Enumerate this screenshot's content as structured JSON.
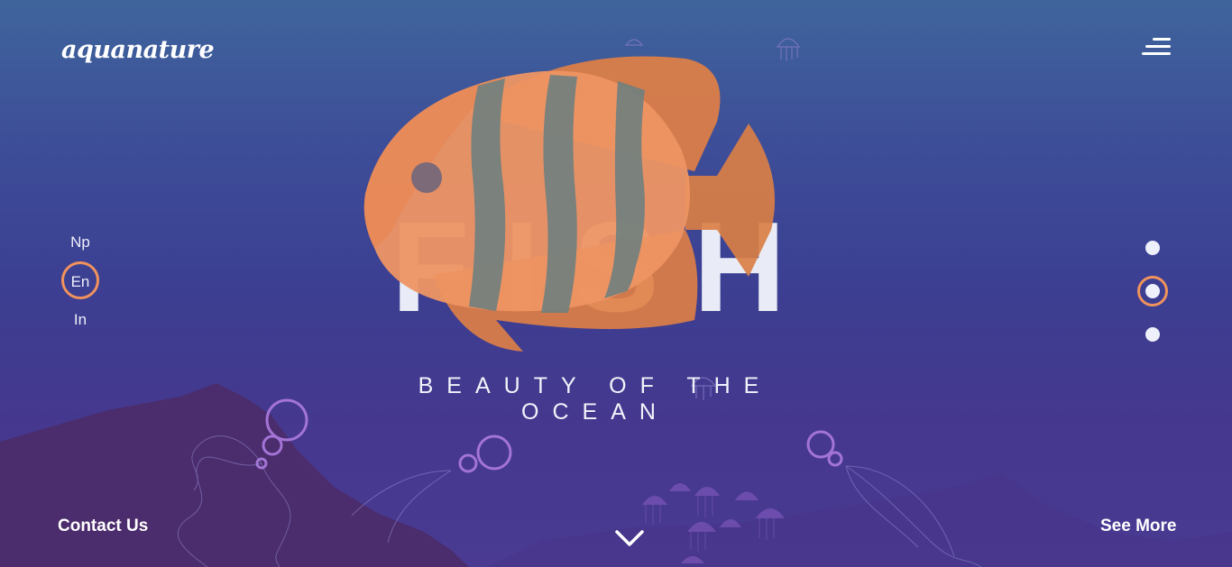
{
  "brand": {
    "logo_text": "aquanature"
  },
  "header": {
    "menu_icon": "hamburger-menu-icon"
  },
  "languages": {
    "items": [
      "Np",
      "En",
      "In"
    ],
    "selected": "En"
  },
  "hero": {
    "title": "FISH",
    "subtitle": "BEAUTY OF THE OCEAN",
    "illustration_icon": "fish-illustration"
  },
  "slider": {
    "total": 3,
    "active": 2
  },
  "footer": {
    "contact_label": "Contact Us",
    "see_more_label": "See More",
    "scroll_icon": "chevron-down-icon"
  },
  "colors": {
    "accent": "#f0925d",
    "fish_body": "#ee9563",
    "fish_stripe": "#6f7f7e",
    "background_top": "#3f649c",
    "background_bottom": "#4a3a92",
    "seabed": "#4b2c6c"
  }
}
